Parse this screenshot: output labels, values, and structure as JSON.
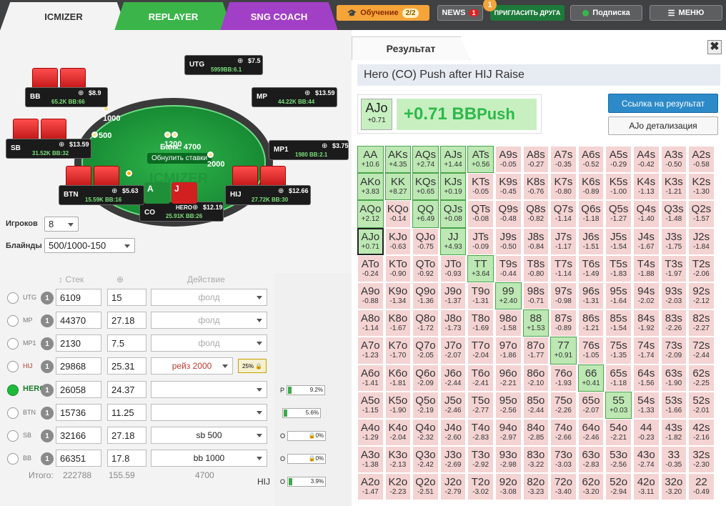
{
  "topbar": {
    "tabs": [
      "ICMIZER",
      "REPLAYER",
      "SNG COACH"
    ],
    "learn_label": "Обучение",
    "learn_count": "2/2",
    "news_label": "NEWS",
    "news_count": "1",
    "invite_badge": "1",
    "invite_label": "ПРИГЛАСИТЬ ДРУГА",
    "subscribe_label": "Подписка",
    "menu_label": "МЕНЮ"
  },
  "table": {
    "pot": "Банк: 4700",
    "reset_label": "Обнулить ставки",
    "watermark": "ICMIZER",
    "seats": [
      {
        "pos": "UTG",
        "amount": "$7.5",
        "stack": "5959BB:6.1"
      },
      {
        "pos": "MP",
        "amount": "$13.59",
        "stack": "44.22K BB:44"
      },
      {
        "pos": "MP1",
        "amount": "$3.75",
        "stack": "1980 BB:2.1"
      },
      {
        "pos": "HIJ",
        "amount": "$12.66",
        "stack": "27.72K BB:30"
      },
      {
        "pos": "HERO",
        "pos_label": "CO",
        "amount": "$12.19",
        "stack": "25.91K BB:26"
      },
      {
        "pos": "BTN",
        "amount": "$5.63",
        "stack": "15.59K BB:16"
      },
      {
        "pos": "SB",
        "amount": "$13.59",
        "stack": "31.52K BB:32"
      },
      {
        "pos": "BB",
        "amount": "$8.9",
        "stack": "65.2K BB:66"
      }
    ],
    "bets": [
      "1000",
      "500",
      "1200",
      "2000"
    ],
    "hero_cards": [
      "A",
      "J"
    ]
  },
  "settings": {
    "players_label": "Игроков",
    "players_value": "8",
    "blinds_label": "Блайнды",
    "blinds_value": "500/1000-150"
  },
  "headers": {
    "stack": "Стек",
    "action": "Действие"
  },
  "players": [
    {
      "name": "UTG",
      "stack": "6109",
      "bb": "15",
      "action": "фолд"
    },
    {
      "name": "MP",
      "stack": "44370",
      "bb": "27.18",
      "action": "фолд"
    },
    {
      "name": "MP1",
      "stack": "2130",
      "bb": "7.5",
      "action": "фолд"
    },
    {
      "name": "HIJ",
      "stack": "29868",
      "bb": "25.31",
      "action": "рейз 2000",
      "pct": "25%"
    },
    {
      "name": "HERO",
      "stack": "26058",
      "bb": "24.37",
      "action": ""
    },
    {
      "name": "BTN",
      "stack": "15736",
      "bb": "11.25",
      "action": ""
    },
    {
      "name": "SB",
      "stack": "32166",
      "bb": "27.18",
      "action": "sb 500"
    },
    {
      "name": "BB",
      "stack": "66351",
      "bb": "17.8",
      "action": "bb 1000"
    }
  ],
  "totals": {
    "label": "Итого:",
    "stack": "222788",
    "bb": "155.59",
    "action": "4700"
  },
  "equity": [
    {
      "label": "P",
      "pct": "9.2%"
    },
    {
      "label": "",
      "pct": "5.6%"
    },
    {
      "label": "O",
      "pct": "0%"
    },
    {
      "label": "O",
      "pct": "0%"
    },
    {
      "label": "O",
      "pct": "3.9%"
    }
  ],
  "mid_label": "HIJ",
  "result": {
    "tab_label": "Результат",
    "close": "✖",
    "scenario": "Hero (CO) Push after HIJ Raise",
    "hand": "AJo",
    "hand_ev": "+0.71",
    "ev_big": "+0.71 BB",
    "ev_action": "Push",
    "link_label": "Ссылка на результат",
    "detail_label": "AJo детализация"
  },
  "grid": [
    [
      [
        "AA",
        "+10.6"
      ],
      [
        "AKs",
        "+4.35"
      ],
      [
        "AQs",
        "+2.74"
      ],
      [
        "AJs",
        "+1.44"
      ],
      [
        "ATs",
        "+0.56"
      ],
      [
        "A9s",
        "-0.05"
      ],
      [
        "A8s",
        "-0.27"
      ],
      [
        "A7s",
        "-0.35"
      ],
      [
        "A6s",
        "-0.52"
      ],
      [
        "A5s",
        "-0.29"
      ],
      [
        "A4s",
        "-0.42"
      ],
      [
        "A3s",
        "-0.50"
      ],
      [
        "A2s",
        "-0.58"
      ]
    ],
    [
      [
        "AKo",
        "+3.83"
      ],
      [
        "KK",
        "+8.27"
      ],
      [
        "KQs",
        "+0.65"
      ],
      [
        "KJs",
        "+0.19"
      ],
      [
        "KTs",
        "-0.05"
      ],
      [
        "K9s",
        "-0.45"
      ],
      [
        "K8s",
        "-0.76"
      ],
      [
        "K7s",
        "-0.80"
      ],
      [
        "K6s",
        "-0.89"
      ],
      [
        "K5s",
        "-1.00"
      ],
      [
        "K4s",
        "-1.13"
      ],
      [
        "K3s",
        "-1.21"
      ],
      [
        "K2s",
        "-1.30"
      ]
    ],
    [
      [
        "AQo",
        "+2.12"
      ],
      [
        "KQo",
        "-0.14"
      ],
      [
        "QQ",
        "+6.49"
      ],
      [
        "QJs",
        "+0.08"
      ],
      [
        "QTs",
        "-0.08"
      ],
      [
        "Q9s",
        "-0.48"
      ],
      [
        "Q8s",
        "-0.82"
      ],
      [
        "Q7s",
        "-1.14"
      ],
      [
        "Q6s",
        "-1.18"
      ],
      [
        "Q5s",
        "-1.27"
      ],
      [
        "Q4s",
        "-1.40"
      ],
      [
        "Q3s",
        "-1.48"
      ],
      [
        "Q2s",
        "-1.57"
      ]
    ],
    [
      [
        "AJo",
        "+0.71"
      ],
      [
        "KJo",
        "-0.63"
      ],
      [
        "QJo",
        "-0.75"
      ],
      [
        "JJ",
        "+4.93"
      ],
      [
        "JTs",
        "-0.09"
      ],
      [
        "J9s",
        "-0.50"
      ],
      [
        "J8s",
        "-0.84"
      ],
      [
        "J7s",
        "-1.17"
      ],
      [
        "J6s",
        "-1.51"
      ],
      [
        "J5s",
        "-1.54"
      ],
      [
        "J4s",
        "-1.67"
      ],
      [
        "J3s",
        "-1.75"
      ],
      [
        "J2s",
        "-1.84"
      ]
    ],
    [
      [
        "ATo",
        "-0.24"
      ],
      [
        "KTo",
        "-0.90"
      ],
      [
        "QTo",
        "-0.92"
      ],
      [
        "JTo",
        "-0.93"
      ],
      [
        "TT",
        "+3.64"
      ],
      [
        "T9s",
        "-0.44"
      ],
      [
        "T8s",
        "-0.80"
      ],
      [
        "T7s",
        "-1.14"
      ],
      [
        "T6s",
        "-1.49"
      ],
      [
        "T5s",
        "-1.83"
      ],
      [
        "T4s",
        "-1.88"
      ],
      [
        "T3s",
        "-1.97"
      ],
      [
        "T2s",
        "-2.06"
      ]
    ],
    [
      [
        "A9o",
        "-0.88"
      ],
      [
        "K9o",
        "-1.34"
      ],
      [
        "Q9o",
        "-1.36"
      ],
      [
        "J9o",
        "-1.37"
      ],
      [
        "T9o",
        "-1.31"
      ],
      [
        "99",
        "+2.40"
      ],
      [
        "98s",
        "-0.71"
      ],
      [
        "97s",
        "-0.98"
      ],
      [
        "96s",
        "-1.31"
      ],
      [
        "95s",
        "-1.64"
      ],
      [
        "94s",
        "-2.02"
      ],
      [
        "93s",
        "-2.03"
      ],
      [
        "92s",
        "-2.12"
      ]
    ],
    [
      [
        "A8o",
        "-1.14"
      ],
      [
        "K8o",
        "-1.67"
      ],
      [
        "Q8o",
        "-1.72"
      ],
      [
        "J8o",
        "-1.73"
      ],
      [
        "T8o",
        "-1.69"
      ],
      [
        "98o",
        "-1.58"
      ],
      [
        "88",
        "+1.53"
      ],
      [
        "87s",
        "-0.89"
      ],
      [
        "86s",
        "-1.21"
      ],
      [
        "85s",
        "-1.54"
      ],
      [
        "84s",
        "-1.92"
      ],
      [
        "83s",
        "-2.26"
      ],
      [
        "82s",
        "-2.27"
      ]
    ],
    [
      [
        "A7o",
        "-1.23"
      ],
      [
        "K7o",
        "-1.70"
      ],
      [
        "Q7o",
        "-2.05"
      ],
      [
        "J7o",
        "-2.07"
      ],
      [
        "T7o",
        "-2.04"
      ],
      [
        "97o",
        "-1.86"
      ],
      [
        "87o",
        "-1.77"
      ],
      [
        "77",
        "+0.91"
      ],
      [
        "76s",
        "-1.05"
      ],
      [
        "75s",
        "-1.35"
      ],
      [
        "74s",
        "-1.74"
      ],
      [
        "73s",
        "-2.09"
      ],
      [
        "72s",
        "-2.44"
      ]
    ],
    [
      [
        "A6o",
        "-1.41"
      ],
      [
        "K6o",
        "-1.81"
      ],
      [
        "Q6o",
        "-2.09"
      ],
      [
        "J6o",
        "-2.44"
      ],
      [
        "T6o",
        "-2.41"
      ],
      [
        "96o",
        "-2.21"
      ],
      [
        "86o",
        "-2.10"
      ],
      [
        "76o",
        "-1.93"
      ],
      [
        "66",
        "+0.41"
      ],
      [
        "65s",
        "-1.18"
      ],
      [
        "64s",
        "-1.56"
      ],
      [
        "63s",
        "-1.90"
      ],
      [
        "62s",
        "-2.25"
      ]
    ],
    [
      [
        "A5o",
        "-1.15"
      ],
      [
        "K5o",
        "-1.90"
      ],
      [
        "Q5o",
        "-2.19"
      ],
      [
        "J5o",
        "-2.46"
      ],
      [
        "T5o",
        "-2.77"
      ],
      [
        "95o",
        "-2.56"
      ],
      [
        "85o",
        "-2.44"
      ],
      [
        "75o",
        "-2.26"
      ],
      [
        "65o",
        "-2.07"
      ],
      [
        "55",
        "+0.03"
      ],
      [
        "54s",
        "-1.33"
      ],
      [
        "53s",
        "-1.66"
      ],
      [
        "52s",
        "-2.01"
      ]
    ],
    [
      [
        "A4o",
        "-1.29"
      ],
      [
        "K4o",
        "-2.04"
      ],
      [
        "Q4o",
        "-2.32"
      ],
      [
        "J4o",
        "-2.60"
      ],
      [
        "T4o",
        "-2.83"
      ],
      [
        "94o",
        "-2.97"
      ],
      [
        "84o",
        "-2.85"
      ],
      [
        "74o",
        "-2.66"
      ],
      [
        "64o",
        "-2.46"
      ],
      [
        "54o",
        "-2.21"
      ],
      [
        "44",
        "-0.23"
      ],
      [
        "43s",
        "-1.82"
      ],
      [
        "42s",
        "-2.16"
      ]
    ],
    [
      [
        "A3o",
        "-1.38"
      ],
      [
        "K3o",
        "-2.13"
      ],
      [
        "Q3o",
        "-2.42"
      ],
      [
        "J3o",
        "-2.69"
      ],
      [
        "T3o",
        "-2.92"
      ],
      [
        "93o",
        "-2.98"
      ],
      [
        "83o",
        "-3.22"
      ],
      [
        "73o",
        "-3.03"
      ],
      [
        "63o",
        "-2.83"
      ],
      [
        "53o",
        "-2.56"
      ],
      [
        "43o",
        "-2.74"
      ],
      [
        "33",
        "-0.35"
      ],
      [
        "32s",
        "-2.30"
      ]
    ],
    [
      [
        "A2o",
        "-1.47"
      ],
      [
        "K2o",
        "-2.23"
      ],
      [
        "Q2o",
        "-2.51"
      ],
      [
        "J2o",
        "-2.79"
      ],
      [
        "T2o",
        "-3.02"
      ],
      [
        "92o",
        "-3.08"
      ],
      [
        "82o",
        "-3.23"
      ],
      [
        "72o",
        "-3.40"
      ],
      [
        "62o",
        "-3.20"
      ],
      [
        "52o",
        "-2.94"
      ],
      [
        "42o",
        "-3.11"
      ],
      [
        "32o",
        "-3.20"
      ],
      [
        "22",
        "-0.49"
      ]
    ]
  ]
}
